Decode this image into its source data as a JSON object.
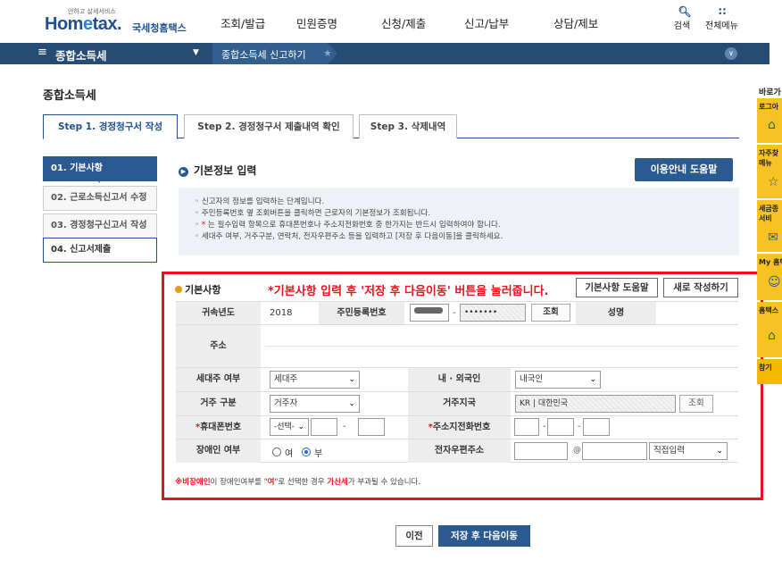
{
  "header": {
    "logo_small": "안하고 살세서비스",
    "logo_main_a": "Hom",
    "logo_main_e": "e",
    "logo_main_b": "tax.",
    "logo_korean": "국세청홈택스",
    "nav": [
      "조회/발급",
      "민원증명",
      "신청/제출",
      "신고/납부",
      "상담/제보"
    ],
    "search_label": "검색",
    "allmenu_label": "전체메뉴"
  },
  "navbar": {
    "menu_title": "종합소득세",
    "crumb": "종합소득세 신고하기"
  },
  "page_title": "종합소득세",
  "tabs": [
    "Step 1. 경정청구서 작성",
    "Step 2. 경정청구서 제출내역 확인",
    "Step 3. 삭제내역"
  ],
  "sidebar": [
    "01. 기본사항",
    "02. 근로소득신고서 수정",
    "03. 경정청구신고서 작성",
    "04. 신고서제출"
  ],
  "info": {
    "heading": "기본정보 입력",
    "help_button": "이용안내 도움말",
    "lines": [
      "신고자의 정보를 입력하는 단계입니다.",
      "주민등록번호 옆 조회버튼을 클릭하면 근로자의 기본정보가 조회됩니다.",
      "는 필수입력 항목으로 휴대폰번호나 주소지전화번호 중 한가지는 반드시 입력하여야 합니다.",
      "세대주 여부, 거주구분, 연락처, 전자우편주소 등을 입력하고 [저장 후 다음이동]을 클릭하세요."
    ]
  },
  "form": {
    "section_title": "기본사항",
    "red_message": "*기본사항 입력 후 '저장 후 다음이동' 버튼을 눌러줍니다.",
    "help_button": "기본사항 도움말",
    "new_button": "새로 작성하기",
    "labels": {
      "year": "귀속년도",
      "rrn": "주민등록번호",
      "name": "성명",
      "address": "주소",
      "household": "세대주 여부",
      "nationality": "내 · 외국인",
      "residence": "거주 구분",
      "country": "거주지국",
      "mobile": "휴대폰번호",
      "phone": "주소지전화번호",
      "disabled": "장애인 여부",
      "email": "전자우편주소"
    },
    "values": {
      "year": "2018",
      "rrn_back": "•••••••",
      "lookup": "조회",
      "household": "세대주",
      "nationality": "내국인",
      "residence": "거주자",
      "country_code": "KR",
      "country_name": "대한민국",
      "mobile_select": "-선택-",
      "radio_yes": "여",
      "radio_no": "부",
      "email_at": "@",
      "email_domain": "직접입력"
    },
    "footnote_a": "※",
    "footnote_b": "비장애인",
    "footnote_c": "이 장애인여부를 \"",
    "footnote_d": "여",
    "footnote_e": "\"로 선택한 경우 ",
    "footnote_f": "가산세",
    "footnote_g": "가 부과될 수 있습니다."
  },
  "buttons": {
    "prev": "이전",
    "next": "저장 후 다음이동"
  },
  "quick": {
    "title": "바로가",
    "items": [
      "로그아",
      "자주찾 메뉴",
      "세금종 서비",
      "My 홈택",
      "홈택스",
      "참기"
    ]
  },
  "colors": {
    "brand": "#1d4f91",
    "navbar": "#274c74",
    "highlight": "#e8131f",
    "quick": "#f7c222"
  }
}
